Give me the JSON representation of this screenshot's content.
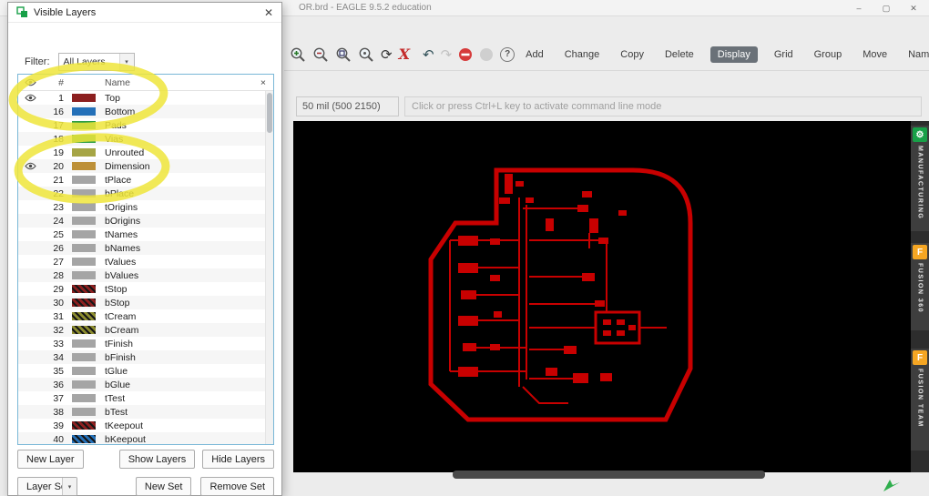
{
  "window": {
    "title": "OR.brd - EAGLE 9.5.2 education"
  },
  "icons": {
    "minimize": "–",
    "maximize": "▢",
    "close": "✕",
    "caret_down": "▾",
    "redraw": "⟳",
    "delete_x": "X",
    "undo": "↶",
    "redo": "↷",
    "help": "?"
  },
  "toolbar": {
    "icon_names": [
      "zoom-in-icon",
      "zoom-out-icon",
      "zoom-fit-icon",
      "zoom-select-icon",
      "redraw-icon",
      "delete-x-icon",
      "undo-icon",
      "redo-icon",
      "stop-icon",
      "go-icon",
      "help-icon"
    ],
    "buttons": [
      "Add",
      "Change",
      "Copy",
      "Delete",
      "Display",
      "Grid",
      "Group",
      "Move",
      "Name"
    ],
    "active_button": "Display"
  },
  "command_bar": {
    "coords": "50 mil (500 2150)",
    "placeholder": "Click or press Ctrl+L key to activate command line mode"
  },
  "dialog": {
    "title": "Visible Layers",
    "filter": {
      "label": "Filter:",
      "value": "All Layers"
    },
    "table": {
      "header": {
        "number": "#",
        "name": "Name",
        "delete": "×"
      },
      "rows": [
        {
          "num": 1,
          "name": "Top",
          "color": "#8c1f1f",
          "pattern": "solid",
          "eye": true
        },
        {
          "num": 16,
          "name": "Bottom",
          "color": "#2470b8",
          "pattern": "solid",
          "eye": false
        },
        {
          "num": 17,
          "name": "Pads",
          "color": "#2f9e44",
          "pattern": "solid",
          "eye": false
        },
        {
          "num": 18,
          "name": "Vias",
          "color": "#2f9e44",
          "pattern": "solid",
          "eye": false
        },
        {
          "num": 19,
          "name": "Unrouted",
          "color": "#a6a545",
          "pattern": "solid",
          "eye": false
        },
        {
          "num": 20,
          "name": "Dimension",
          "color": "#bd9038",
          "pattern": "solid",
          "eye": true
        },
        {
          "num": 21,
          "name": "tPlace",
          "color": "#a5a5a5",
          "pattern": "solid",
          "eye": false
        },
        {
          "num": 22,
          "name": "bPlace",
          "color": "#a5a5a5",
          "pattern": "solid",
          "eye": false
        },
        {
          "num": 23,
          "name": "tOrigins",
          "color": "#a5a5a5",
          "pattern": "solid",
          "eye": false
        },
        {
          "num": 24,
          "name": "bOrigins",
          "color": "#a5a5a5",
          "pattern": "solid",
          "eye": false
        },
        {
          "num": 25,
          "name": "tNames",
          "color": "#a5a5a5",
          "pattern": "solid",
          "eye": false
        },
        {
          "num": 26,
          "name": "bNames",
          "color": "#a5a5a5",
          "pattern": "solid",
          "eye": false
        },
        {
          "num": 27,
          "name": "tValues",
          "color": "#a5a5a5",
          "pattern": "solid",
          "eye": false
        },
        {
          "num": 28,
          "name": "bValues",
          "color": "#a5a5a5",
          "pattern": "solid",
          "eye": false
        },
        {
          "num": 29,
          "name": "tStop",
          "color": "#8c1f1f",
          "pattern": "hatch",
          "eye": false
        },
        {
          "num": 30,
          "name": "bStop",
          "color": "#8c1f1f",
          "pattern": "hatch",
          "eye": false
        },
        {
          "num": 31,
          "name": "tCream",
          "color": "#8c8c2f",
          "pattern": "hatch",
          "eye": false
        },
        {
          "num": 32,
          "name": "bCream",
          "color": "#8c8c2f",
          "pattern": "hatch",
          "eye": false
        },
        {
          "num": 33,
          "name": "tFinish",
          "color": "#a5a5a5",
          "pattern": "solid",
          "eye": false
        },
        {
          "num": 34,
          "name": "bFinish",
          "color": "#a5a5a5",
          "pattern": "solid",
          "eye": false
        },
        {
          "num": 35,
          "name": "tGlue",
          "color": "#a5a5a5",
          "pattern": "solid",
          "eye": false
        },
        {
          "num": 36,
          "name": "bGlue",
          "color": "#a5a5a5",
          "pattern": "solid",
          "eye": false
        },
        {
          "num": 37,
          "name": "tTest",
          "color": "#a5a5a5",
          "pattern": "solid",
          "eye": false
        },
        {
          "num": 38,
          "name": "bTest",
          "color": "#a5a5a5",
          "pattern": "solid",
          "eye": false
        },
        {
          "num": 39,
          "name": "tKeepout",
          "color": "#8c1f1f",
          "pattern": "hatch",
          "eye": false
        },
        {
          "num": 40,
          "name": "bKeepout",
          "color": "#2470b8",
          "pattern": "hatch",
          "eye": false
        }
      ]
    },
    "buttons": {
      "new_layer": "New Layer",
      "show_layers": "Show Layers",
      "hide_layers": "Hide Layers",
      "layer_sets": "Layer Sets",
      "new_set": "New Set",
      "remove_set": "Remove Set"
    }
  },
  "sidebar_tabs": [
    {
      "label": "MANUFACTURING",
      "icon": "manufacturing-icon",
      "icon_glyph": "⚙",
      "icon_color": "#18a048"
    },
    {
      "label": "FUSION 360",
      "icon": "fusion-360-icon",
      "icon_glyph": "F",
      "icon_color": "#f5a623"
    },
    {
      "label": "FUSION TEAM",
      "icon": "fusion-team-icon",
      "icon_glyph": "F",
      "icon_color": "#f5a623"
    }
  ],
  "colors": {
    "trace_red": "#c80000",
    "highlight_yellow": "#efe63b"
  }
}
